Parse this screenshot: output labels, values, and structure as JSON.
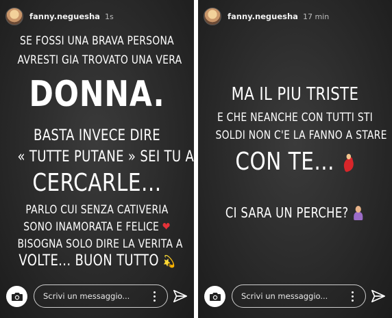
{
  "stories": [
    {
      "username": "fanny.neguesha",
      "time": "1s",
      "lines": [
        "SE FOSSI UNA BRAVA PERSONA",
        "AVRESTI GIA TROVATO UNA VERA",
        "DONNA.",
        "BASTA INVECE DIRE",
        "« TUTTE PUTANE » SEI TU A",
        "CERCARLE...",
        "PARLO CUI SENZA CATIVERIA",
        "SONO INAMORATA E FELICE",
        "BISOGNA SOLO DIRE LA VERITA A",
        "VOLTE... BUON TUTTO"
      ],
      "emojis": {
        "heart": "❤",
        "dizzy": "💫"
      },
      "reply_placeholder": "Scrivi un messaggio..."
    },
    {
      "username": "fanny.neguesha",
      "time": "17 min",
      "lines": [
        "MA IL PIU TRISTE",
        "E CHE NEANCHE CON TUTTI STI",
        "SOLDI NON C'E LA FANNO A STARE",
        "CON TE...",
        "CI SARA UN PERCHE?"
      ],
      "emojis": {
        "dancer": "woman-dancing-emoji",
        "shrug": "person-shrugging-emoji"
      },
      "reply_placeholder": "Scrivi un messaggio..."
    }
  ],
  "icons": {
    "camera": "camera-icon",
    "more": "more-vertical-icon",
    "send": "send-paper-plane-icon"
  },
  "colors": {
    "background": "#2a2a2a",
    "text": "#ffffff",
    "separator": "#ffffff"
  }
}
